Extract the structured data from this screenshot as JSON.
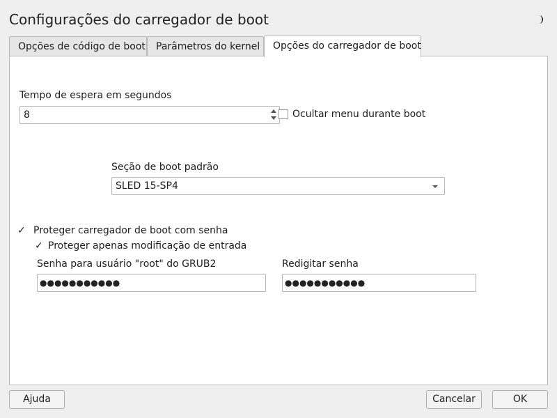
{
  "window": {
    "title": "Configurações do carregador de boot"
  },
  "tabs": [
    {
      "label": "Opções de código de boot"
    },
    {
      "label": "Parâmetros do kernel"
    },
    {
      "label": "Opções do carregador de boot"
    }
  ],
  "timeout": {
    "label": "Tempo de espera em segundos",
    "value": "8"
  },
  "hide_menu": {
    "label": "Ocultar menu durante boot",
    "checked": false
  },
  "default_section": {
    "label": "Seção de boot padrão",
    "selected": "SLED 15-SP4"
  },
  "protect": {
    "label": "Proteger carregador de boot com senha",
    "checked": true,
    "entry_only_label": "Proteger apenas modificação de entrada",
    "entry_only_checked": true
  },
  "password": {
    "label": "Senha para usuário \"root\" do GRUB2",
    "value": "●●●●●●●●●●●"
  },
  "retype": {
    "label": "Redigitar senha",
    "value": "●●●●●●●●●●●"
  },
  "buttons": {
    "help": "Ajuda",
    "cancel": "Cancelar",
    "ok": "OK"
  }
}
